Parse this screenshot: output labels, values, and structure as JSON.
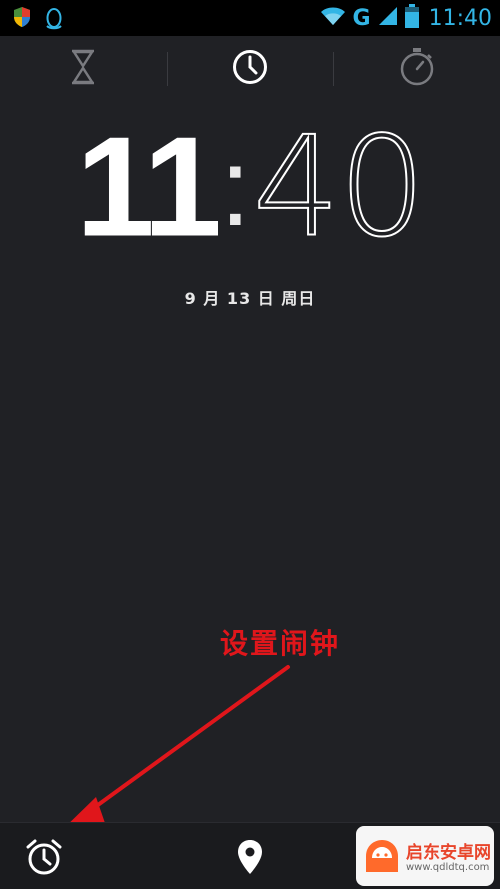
{
  "status_bar": {
    "network": "G",
    "time": "11:40"
  },
  "tabs": [
    {
      "name": "timer",
      "icon": "hourglass-icon",
      "active": false
    },
    {
      "name": "clock",
      "icon": "clock-icon",
      "active": true
    },
    {
      "name": "stopwatch",
      "icon": "stopwatch-icon",
      "active": false
    }
  ],
  "clock": {
    "hours": "11",
    "separator": ":",
    "minutes": "40",
    "date": "9 月 13 日 周日"
  },
  "annotation": {
    "text": "设置闹钟",
    "color": "#e0161b"
  },
  "bottom_bar": {
    "items": [
      "alarm-icon",
      "location-icon",
      "menu-icon"
    ]
  },
  "watermark": {
    "title": "启东安卓网",
    "url": "www.qdldtq.com"
  },
  "colors": {
    "background": "#202125",
    "status_accent": "#33b5e5",
    "annotation": "#e0161b"
  }
}
